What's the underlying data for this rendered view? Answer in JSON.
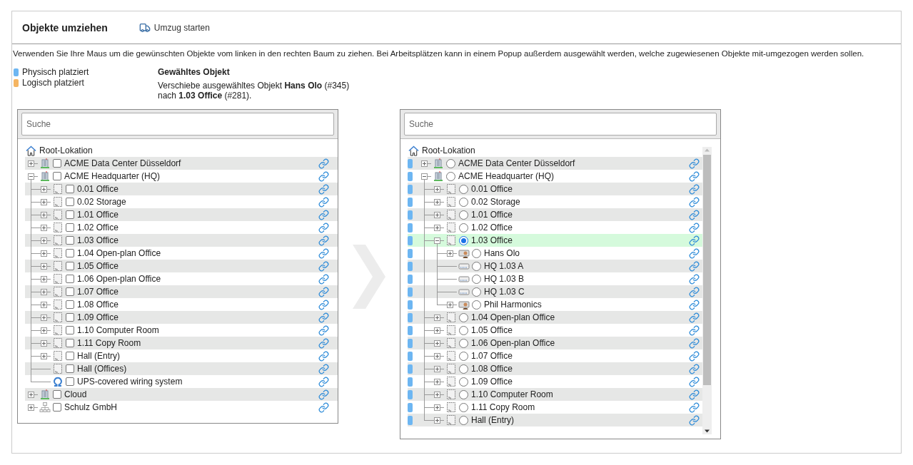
{
  "header": {
    "title": "Objekte umziehen",
    "action": "Umzug starten"
  },
  "instructions": "Verwenden Sie Ihre Maus um die gewünschten Objekte vom linken in den rechten Baum zu ziehen. Bei Arbeitsplätzen kann in einem Popup außerdem ausgewählt werden, welche zugewiesenen Objekte mit-umgezogen werden sollen.",
  "legend": [
    {
      "label": "Physisch platziert",
      "color": "#6db6f2"
    },
    {
      "label": "Logisch platziert",
      "color": "#f5b562"
    }
  ],
  "selection": {
    "heading": "Gewähltes Objekt",
    "lines": [
      "Verschiebe ausgewähltes Objekt **Hans Olo** (#345)",
      "nach **1.03 Office** (#281)."
    ]
  },
  "source_tree": {
    "search": {
      "placeholder": "Suche"
    },
    "root": "Root-Lokation",
    "nodes": [
      {
        "label": "ACME Data Center Düsseldorf",
        "kind": "site",
        "expanded": false,
        "checked": false
      },
      {
        "label": "ACME Headquarter (HQ)",
        "kind": "site",
        "expanded": true,
        "checked": false,
        "children": [
          {
            "label": "0.01 Office",
            "kind": "room",
            "expanded": false,
            "checked": false
          },
          {
            "label": "0.02 Storage",
            "kind": "room",
            "expanded": false,
            "checked": false
          },
          {
            "label": "1.01 Office",
            "kind": "room",
            "expanded": false,
            "checked": false
          },
          {
            "label": "1.02 Office",
            "kind": "room",
            "expanded": false,
            "checked": false
          },
          {
            "label": "1.03 Office",
            "kind": "room",
            "expanded": false,
            "checked": false
          },
          {
            "label": "1.04 Open-plan Office",
            "kind": "room",
            "expanded": false,
            "checked": false
          },
          {
            "label": "1.05 Office",
            "kind": "room",
            "expanded": false,
            "checked": false
          },
          {
            "label": "1.06 Open-plan Office",
            "kind": "room",
            "expanded": false,
            "checked": false
          },
          {
            "label": "1.07 Office",
            "kind": "room",
            "expanded": false,
            "checked": false
          },
          {
            "label": "1.08 Office",
            "kind": "room",
            "expanded": false,
            "checked": false
          },
          {
            "label": "1.09 Office",
            "kind": "room",
            "expanded": false,
            "checked": false
          },
          {
            "label": "1.10 Computer Room",
            "kind": "room",
            "expanded": false,
            "checked": false
          },
          {
            "label": "1.11 Copy Room",
            "kind": "room",
            "expanded": false,
            "checked": false
          },
          {
            "label": "Hall (Entry)",
            "kind": "room",
            "expanded": false,
            "checked": false
          },
          {
            "label": "Hall (Offices)",
            "kind": "room",
            "checked": false
          },
          {
            "label": "UPS-covered wiring system",
            "kind": "cable",
            "checked": false
          }
        ]
      },
      {
        "label": "Cloud",
        "kind": "site",
        "expanded": false,
        "checked": false
      },
      {
        "label": "Schulz GmbH",
        "kind": "company",
        "expanded": false,
        "checked": false
      }
    ]
  },
  "target_tree": {
    "search": {
      "placeholder": "Suche"
    },
    "root": "Root-Lokation",
    "nodes": [
      {
        "label": "ACME Data Center Düsseldorf",
        "kind": "site",
        "expanded": false,
        "selected": false,
        "color": "#6db6f2"
      },
      {
        "label": "ACME Headquarter (HQ)",
        "kind": "site",
        "expanded": true,
        "selected": false,
        "color": "#6db6f2",
        "children": [
          {
            "label": "0.01 Office",
            "kind": "room",
            "expanded": false,
            "selected": false,
            "color": "#6db6f2"
          },
          {
            "label": "0.02 Storage",
            "kind": "room",
            "expanded": false,
            "selected": false,
            "color": "#6db6f2"
          },
          {
            "label": "1.01 Office",
            "kind": "room",
            "expanded": false,
            "selected": false,
            "color": "#6db6f2"
          },
          {
            "label": "1.02 Office",
            "kind": "room",
            "expanded": false,
            "selected": false,
            "color": "#6db6f2"
          },
          {
            "label": "1.03 Office",
            "kind": "room",
            "expanded": true,
            "selected": true,
            "color": "#6db6f2",
            "children": [
              {
                "label": "Hans Olo",
                "kind": "workplace",
                "expanded": false,
                "selected": false,
                "color": "#6db6f2"
              },
              {
                "label": "HQ 1.03 A",
                "kind": "device",
                "selected": false,
                "color": "#6db6f2"
              },
              {
                "label": "HQ 1.03 B",
                "kind": "device",
                "selected": false,
                "color": "#6db6f2"
              },
              {
                "label": "HQ 1.03 C",
                "kind": "device",
                "selected": false,
                "color": "#6db6f2"
              },
              {
                "label": "Phil Harmonics",
                "kind": "workplace",
                "expanded": false,
                "selected": false,
                "color": "#6db6f2"
              }
            ]
          },
          {
            "label": "1.04 Open-plan Office",
            "kind": "room",
            "expanded": false,
            "selected": false,
            "color": "#6db6f2"
          },
          {
            "label": "1.05 Office",
            "kind": "room",
            "expanded": false,
            "selected": false,
            "color": "#6db6f2"
          },
          {
            "label": "1.06 Open-plan Office",
            "kind": "room",
            "expanded": false,
            "selected": false,
            "color": "#6db6f2"
          },
          {
            "label": "1.07 Office",
            "kind": "room",
            "expanded": false,
            "selected": false,
            "color": "#6db6f2"
          },
          {
            "label": "1.08 Office",
            "kind": "room",
            "expanded": false,
            "selected": false,
            "color": "#6db6f2"
          },
          {
            "label": "1.09 Office",
            "kind": "room",
            "expanded": false,
            "selected": false,
            "color": "#6db6f2"
          },
          {
            "label": "1.10 Computer Room",
            "kind": "room",
            "expanded": false,
            "selected": false,
            "color": "#6db6f2"
          },
          {
            "label": "1.11 Copy Room",
            "kind": "room",
            "expanded": false,
            "selected": false,
            "color": "#6db6f2"
          },
          {
            "label": "Hall (Entry)",
            "kind": "room",
            "expanded": false,
            "selected": false,
            "color": "#6db6f2"
          }
        ]
      }
    ]
  }
}
